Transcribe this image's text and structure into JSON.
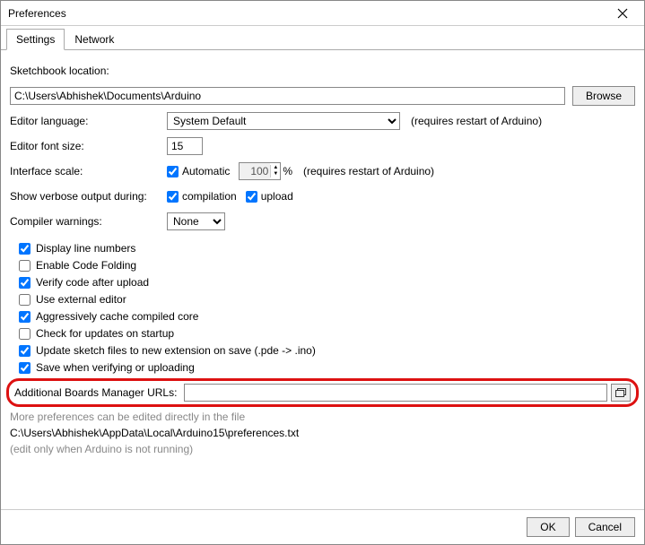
{
  "window": {
    "title": "Preferences"
  },
  "tabs": {
    "settings": "Settings",
    "network": "Network"
  },
  "labels": {
    "sketchbook": "Sketchbook location:",
    "browse": "Browse",
    "language": "Editor language:",
    "fontsize": "Editor font size:",
    "scale": "Interface scale:",
    "automatic": "Automatic",
    "percent": "%",
    "restart_note": "(requires restart of Arduino)",
    "verbose": "Show verbose output during:",
    "compilation": "compilation",
    "upload": "upload",
    "warnings": "Compiler warnings:",
    "additional_urls": "Additional Boards Manager URLs:",
    "more_prefs": "More preferences can be edited directly in the file",
    "edit_note": "(edit only when Arduino is not running)",
    "ok": "OK",
    "cancel": "Cancel"
  },
  "values": {
    "sketchbook_path": "C:\\Users\\Abhishek\\Documents\\Arduino",
    "language": "System Default",
    "fontsize": "15",
    "scale": "100",
    "warnings": "None",
    "additional_urls": "",
    "prefs_path": "C:\\Users\\Abhishek\\AppData\\Local\\Arduino15\\preferences.txt"
  },
  "checkboxes": {
    "display_line_numbers": "Display line numbers",
    "enable_code_folding": "Enable Code Folding",
    "verify_after_upload": "Verify code after upload",
    "external_editor": "Use external editor",
    "cache_core": "Aggressively cache compiled core",
    "check_updates": "Check for updates on startup",
    "update_extension": "Update sketch files to new extension on save (.pde -> .ino)",
    "save_on_verify": "Save when verifying or uploading"
  }
}
